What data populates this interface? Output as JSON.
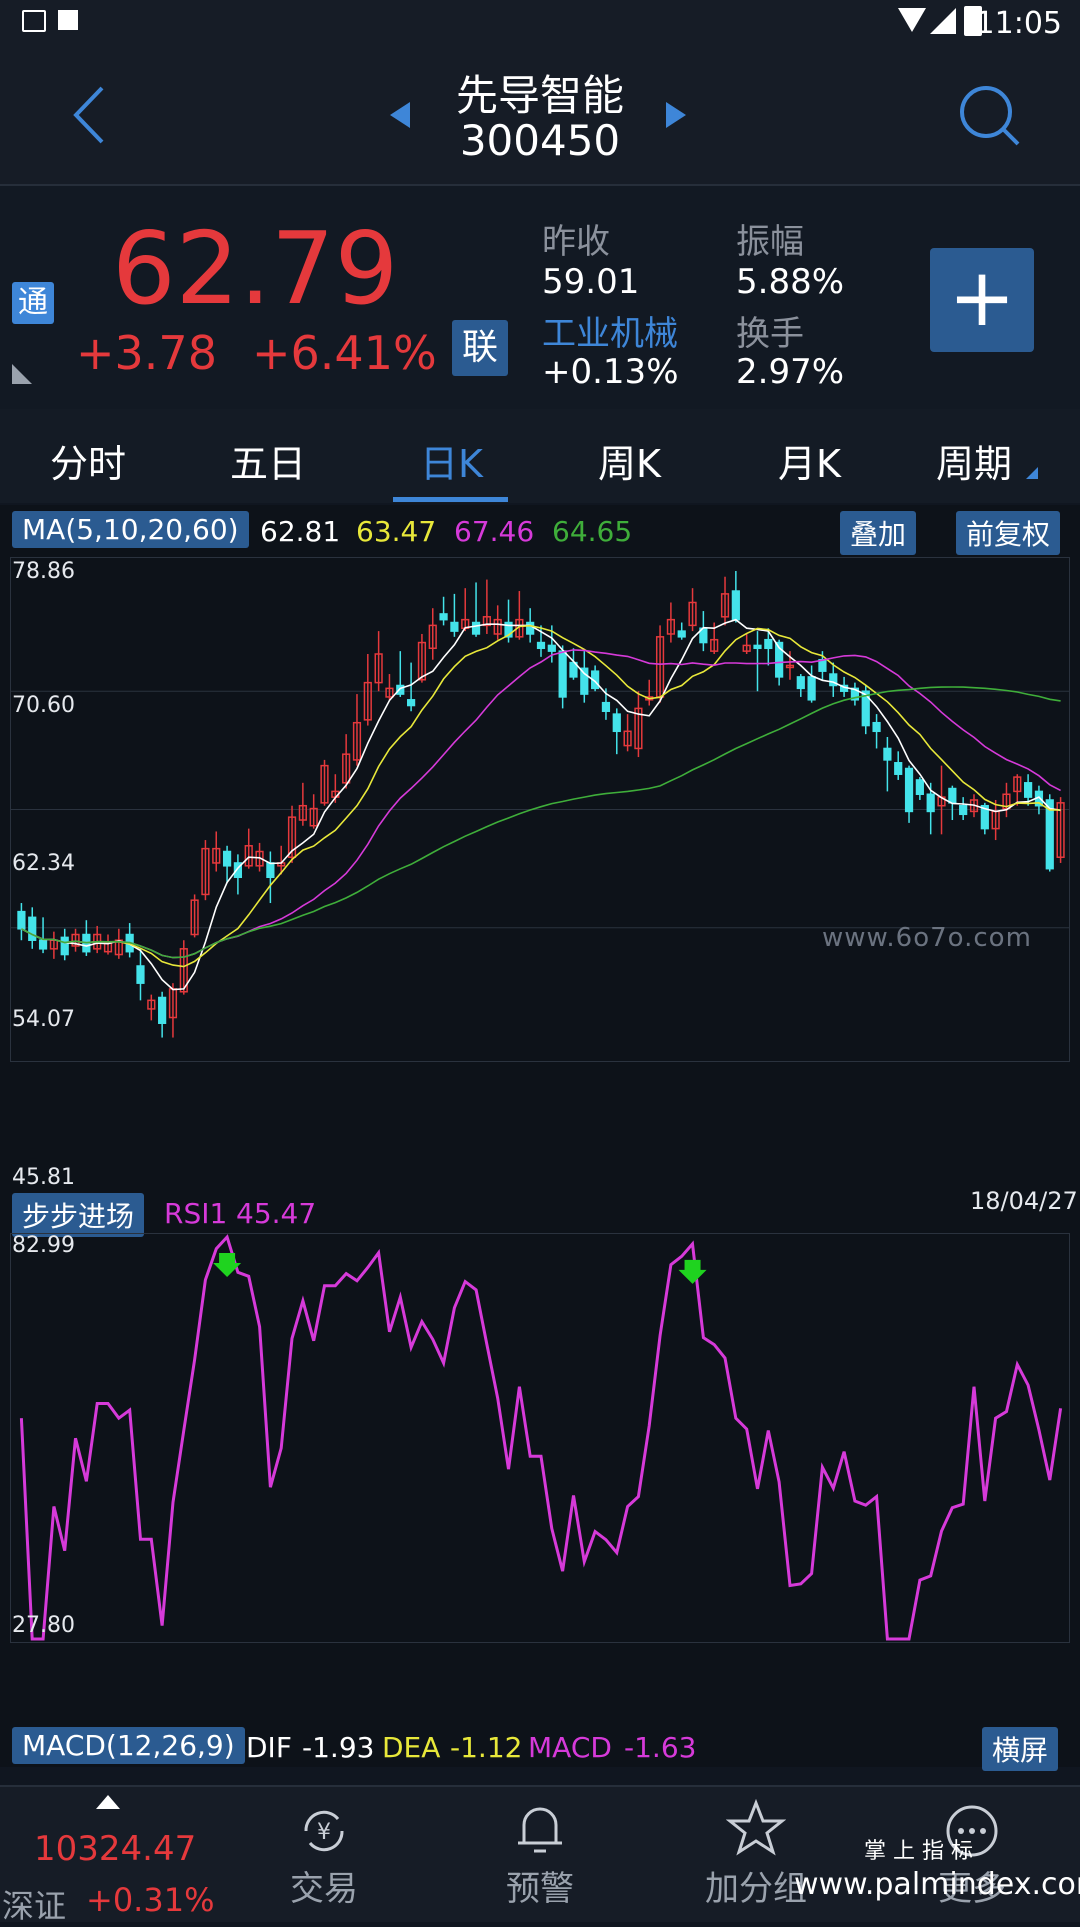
{
  "status_bar": {
    "time": "11:05"
  },
  "header": {
    "stock_name": "先导智能",
    "stock_code": "300450"
  },
  "quote": {
    "price": "62.79",
    "change": "+3.78",
    "change_pct": "+6.41%",
    "tong_badge": "通",
    "lian_badge": "联",
    "prev_close_label": "昨收",
    "prev_close": "59.01",
    "amplitude_label": "振幅",
    "amplitude": "5.88%",
    "industry_label": "工业机械",
    "industry_change": "+0.13%",
    "turnover_label": "换手",
    "turnover": "2.97%",
    "add_button": "+"
  },
  "tabs": [
    "分时",
    "五日",
    "日K",
    "周K",
    "月K",
    "周期"
  ],
  "active_tab": 2,
  "ma_legend": {
    "label": "MA(5,10,20,60)",
    "ma5": "62.81",
    "ma10": "63.47",
    "ma20": "67.46",
    "ma60": "64.65",
    "overlay_button": "叠加",
    "adjust_button": "前复权"
  },
  "price_axis": [
    "78.86",
    "70.60",
    "62.34",
    "54.07",
    "45.81"
  ],
  "watermark": "www.6o7o.com",
  "rsi_panel": {
    "badge": "步步进场",
    "label": "RSI1",
    "value": "45.47",
    "date": "18/04/27",
    "ymax": "82.99",
    "ymin": "27.80"
  },
  "macd": {
    "label": "MACD(12,26,9)",
    "dif_label": "DIF",
    "dif": "-1.93",
    "dea_label": "DEA",
    "dea": "-1.12",
    "macd_label": "MACD",
    "macd_value": "-1.63",
    "landscape_button": "横屏"
  },
  "bottom_nav": {
    "index_value": "10324.47",
    "index_name": "深证",
    "index_change": "+0.31%",
    "items": [
      "交易",
      "预警",
      "加分组",
      "更多"
    ]
  },
  "watermark2": {
    "line1": "掌 上 指 标",
    "line2": "www.palmindex.com"
  },
  "colors": {
    "up": "#e5393c",
    "down": "#44e3ea",
    "ma5": "#ffffff",
    "ma10": "#e8e83a",
    "ma20": "#d63ad9",
    "ma60": "#3fae3a",
    "rsi": "#d63ad9",
    "accent": "#3e86d8"
  },
  "chart_data": {
    "type": "candlestick",
    "ylim": [
      45.81,
      78.86
    ],
    "candles": [
      [
        55.2,
        54.0,
        55.8,
        53.2
      ],
      [
        54.8,
        53.2,
        55.5,
        52.6
      ],
      [
        53.2,
        52.6,
        54.8,
        52.3
      ],
      [
        52.6,
        53.2,
        53.8,
        51.9
      ],
      [
        53.4,
        52.2,
        54.0,
        51.8
      ],
      [
        52.8,
        53.6,
        54.0,
        52.4
      ],
      [
        53.6,
        52.4,
        54.6,
        52.1
      ],
      [
        52.6,
        53.6,
        54.2,
        52.3
      ],
      [
        52.4,
        53.0,
        53.6,
        52.2
      ],
      [
        52.2,
        53.2,
        54.0,
        51.9
      ],
      [
        53.6,
        52.4,
        54.4,
        52.0
      ],
      [
        51.4,
        50.2,
        52.6,
        49.0
      ],
      [
        48.4,
        49.0,
        49.4,
        47.6
      ],
      [
        49.2,
        47.4,
        49.6,
        46.4
      ],
      [
        47.8,
        49.8,
        50.2,
        46.4
      ],
      [
        49.6,
        52.6,
        53.2,
        49.4
      ],
      [
        53.6,
        56.0,
        56.4,
        53.4
      ],
      [
        56.4,
        59.6,
        60.2,
        56.0
      ],
      [
        58.6,
        59.6,
        60.8,
        58.0
      ],
      [
        59.4,
        58.4,
        59.8,
        57.2
      ],
      [
        58.6,
        57.6,
        59.2,
        56.4
      ],
      [
        58.4,
        59.8,
        61.0,
        58.2
      ],
      [
        58.4,
        59.4,
        60.0,
        58.0
      ],
      [
        58.6,
        57.6,
        59.4,
        55.8
      ],
      [
        58.4,
        58.6,
        59.8,
        57.8
      ],
      [
        59.0,
        61.8,
        62.6,
        58.6
      ],
      [
        61.6,
        62.6,
        64.2,
        61.2
      ],
      [
        61.2,
        62.4,
        63.4,
        61.0
      ],
      [
        62.8,
        65.4,
        65.8,
        62.6
      ],
      [
        63.2,
        63.6,
        64.8,
        62.8
      ],
      [
        64.2,
        66.2,
        67.6,
        63.8
      ],
      [
        65.8,
        68.4,
        70.4,
        65.4
      ],
      [
        68.6,
        71.2,
        73.2,
        68.2
      ],
      [
        71.2,
        73.2,
        74.8,
        70.6
      ],
      [
        70.2,
        70.8,
        71.8,
        70.0
      ],
      [
        71.0,
        70.4,
        73.4,
        70.2
      ],
      [
        70.0,
        69.6,
        72.6,
        69.2
      ],
      [
        71.4,
        74.0,
        74.6,
        71.2
      ],
      [
        73.6,
        75.2,
        76.4,
        72.8
      ],
      [
        76.0,
        75.6,
        77.2,
        75.2
      ],
      [
        75.4,
        74.8,
        77.4,
        74.4
      ],
      [
        75.0,
        75.6,
        77.8,
        74.8
      ],
      [
        75.4,
        74.6,
        78.2,
        74.4
      ],
      [
        75.2,
        75.8,
        78.4,
        74.6
      ],
      [
        74.6,
        75.6,
        76.6,
        74.2
      ],
      [
        75.4,
        74.4,
        77.0,
        74.0
      ],
      [
        74.4,
        75.6,
        77.6,
        74.2
      ],
      [
        75.4,
        74.6,
        76.4,
        74.0
      ],
      [
        74.0,
        73.6,
        75.2,
        73.0
      ],
      [
        73.8,
        73.4,
        75.2,
        72.6
      ],
      [
        73.4,
        70.2,
        73.8,
        69.4
      ],
      [
        72.6,
        71.6,
        73.6,
        71.4
      ],
      [
        72.2,
        70.4,
        73.4,
        69.8
      ],
      [
        72.0,
        70.8,
        72.4,
        70.6
      ],
      [
        69.8,
        69.2,
        70.8,
        68.6
      ],
      [
        69.0,
        67.8,
        69.4,
        66.2
      ],
      [
        66.8,
        67.8,
        69.0,
        66.4
      ],
      [
        66.6,
        69.4,
        70.6,
        66.0
      ],
      [
        70.0,
        70.2,
        71.4,
        69.6
      ],
      [
        70.2,
        74.4,
        75.2,
        69.8
      ],
      [
        74.6,
        75.6,
        76.8,
        74.0
      ],
      [
        74.8,
        74.4,
        75.4,
        74.2
      ],
      [
        75.2,
        76.8,
        77.8,
        74.8
      ],
      [
        75.0,
        74.0,
        76.2,
        73.4
      ],
      [
        73.4,
        74.2,
        75.4,
        73.2
      ],
      [
        75.8,
        77.4,
        78.6,
        75.2
      ],
      [
        77.6,
        75.6,
        79.0,
        75.4
      ],
      [
        73.4,
        73.8,
        74.6,
        73.2
      ],
      [
        73.8,
        73.6,
        74.8,
        70.6
      ],
      [
        74.2,
        73.6,
        75.0,
        72.4
      ],
      [
        74.0,
        71.6,
        74.2,
        71.0
      ],
      [
        72.4,
        72.4,
        73.4,
        71.4
      ],
      [
        71.6,
        70.8,
        71.8,
        70.2
      ],
      [
        71.6,
        70.0,
        72.4,
        69.8
      ],
      [
        72.8,
        72.0,
        73.4,
        71.4
      ],
      [
        71.8,
        71.0,
        72.6,
        70.2
      ],
      [
        71.0,
        70.6,
        71.6,
        70.2
      ],
      [
        70.8,
        70.0,
        71.2,
        69.6
      ],
      [
        70.6,
        68.2,
        71.0,
        67.6
      ],
      [
        68.4,
        67.8,
        69.0,
        66.6
      ],
      [
        66.6,
        65.8,
        67.4,
        63.6
      ],
      [
        65.6,
        64.8,
        66.4,
        64.4
      ],
      [
        65.2,
        62.2,
        65.4,
        61.4
      ],
      [
        64.4,
        63.4,
        64.6,
        63.0
      ],
      [
        63.4,
        62.2,
        64.2,
        60.6
      ],
      [
        62.6,
        63.2,
        65.4,
        60.6
      ],
      [
        63.8,
        62.8,
        64.0,
        61.6
      ],
      [
        62.6,
        62.0,
        63.2,
        61.6
      ],
      [
        62.2,
        63.0,
        63.4,
        61.8
      ],
      [
        62.6,
        61.0,
        62.8,
        60.6
      ],
      [
        61.0,
        62.2,
        63.0,
        60.2
      ],
      [
        62.4,
        63.4,
        64.2,
        61.8
      ],
      [
        63.6,
        64.6,
        64.8,
        62.6
      ],
      [
        64.2,
        63.2,
        64.8,
        62.6
      ],
      [
        63.6,
        62.6,
        64.0,
        62.0
      ],
      [
        63.0,
        58.2,
        63.4,
        58.0
      ],
      [
        59.0,
        62.8,
        63.2,
        58.6
      ]
    ]
  }
}
